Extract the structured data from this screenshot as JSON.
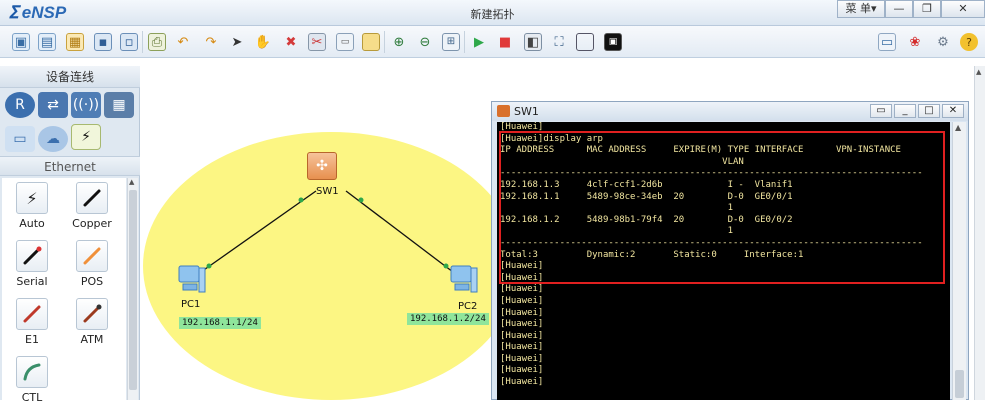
{
  "app": {
    "logo_text": "eNSP",
    "window_title": "新建拓扑",
    "menu_label": "菜 单▾",
    "min_label": "—",
    "restore_label": "❐",
    "close_label": "✕"
  },
  "toolbar": {
    "icons": [
      "new-topology-icon",
      "new-blank-icon",
      "open-icon",
      "save-icon",
      "save-as-icon",
      "print-icon",
      "undo-icon",
      "redo-icon",
      "select-icon",
      "hand-icon",
      "delete-icon",
      "delete-link-icon",
      "text-icon",
      "palette-icon",
      "zoom-in-icon",
      "zoom-out-icon",
      "fit-icon",
      "start-icon",
      "stop-icon",
      "capture-icon",
      "topo-icon",
      "frame-icon",
      "screenshot-icon"
    ],
    "right_icons": [
      "chat-icon",
      "huawei-icon",
      "settings-icon",
      "help-icon"
    ]
  },
  "left_panel": {
    "header": "设备连线",
    "section": "Ethernet",
    "cables": [
      {
        "label": "Auto"
      },
      {
        "label": "Copper"
      },
      {
        "label": "Serial"
      },
      {
        "label": "POS"
      },
      {
        "label": "E1"
      },
      {
        "label": "ATM"
      },
      {
        "label": "CTL"
      }
    ]
  },
  "topology": {
    "sw1_label": "SW1",
    "pc1_label": "PC1",
    "pc2_label": "PC2",
    "pc1_ip": "192.168.1.1/24",
    "pc2_ip": "192.168.1.2/24"
  },
  "terminal": {
    "title": "SW1",
    "lines": [
      "[Huawei]",
      "[Huawei]display arp",
      "IP ADDRESS      MAC ADDRESS     EXPIRE(M) TYPE INTERFACE      VPN-INSTANCE",
      "                                         VLAN",
      "------------------------------------------------------------------------------",
      "192.168.1.3     4clf-ccf1-2d6b            I -  Vlanif1",
      "192.168.1.1     5489-98ce-34eb  20        D-0  GE0/0/1",
      "                                          1",
      "192.168.1.2     5489-98b1-79f4  20        D-0  GE0/0/2",
      "                                          1",
      "------------------------------------------------------------------------------",
      "Total:3         Dynamic:2       Static:0     Interface:1",
      "[Huawei]",
      "[Huawei]",
      "[Huawei]",
      "[Huawei]",
      "[Huawei]",
      "[Huawei]",
      "[Huawei]",
      "[Huawei]",
      "[Huawei]",
      "[Huawei]",
      "[Huawei]"
    ]
  }
}
